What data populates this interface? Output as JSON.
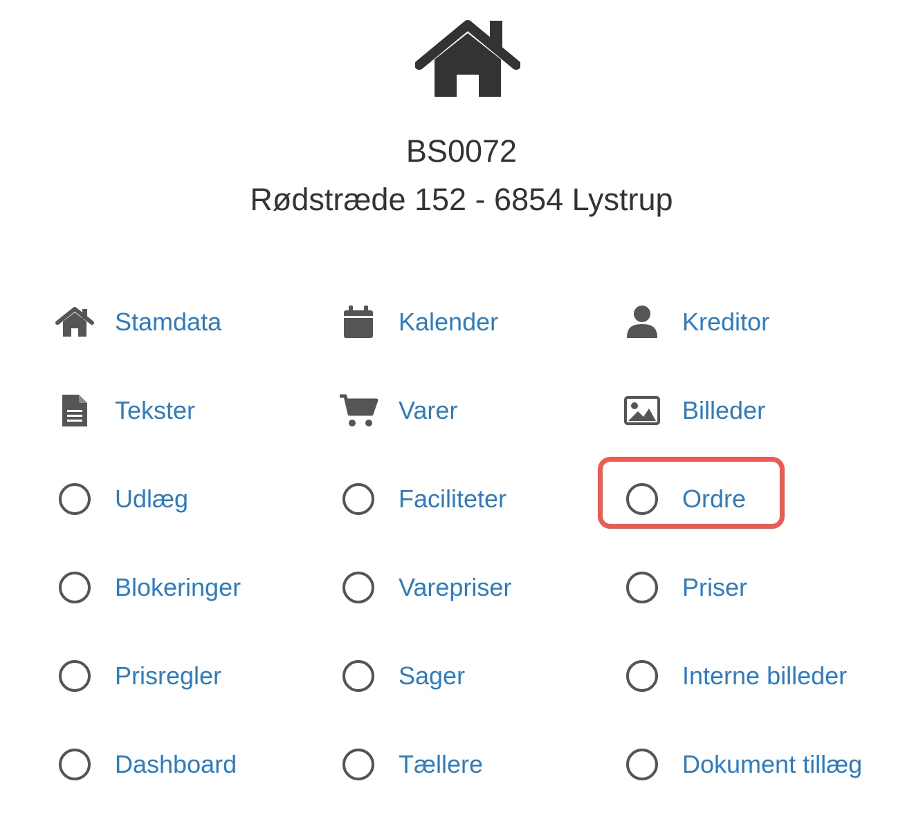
{
  "header": {
    "icon": "house-icon",
    "property_id": "BS0072",
    "address": "Rødstræde 152 - 6854 Lystrup"
  },
  "colors": {
    "link": "#2d7cc1",
    "icon": "#555555",
    "text": "#333333",
    "highlight": "#ee5a4f"
  },
  "menu": {
    "items": [
      {
        "label": "Stamdata",
        "icon": "home-icon"
      },
      {
        "label": "Kalender",
        "icon": "calendar-icon"
      },
      {
        "label": "Kreditor",
        "icon": "user-icon"
      },
      {
        "label": "Tekster",
        "icon": "document-icon"
      },
      {
        "label": "Varer",
        "icon": "cart-icon"
      },
      {
        "label": "Billeder",
        "icon": "image-icon"
      },
      {
        "label": "Udlæg",
        "icon": "circle-icon"
      },
      {
        "label": "Faciliteter",
        "icon": "circle-icon"
      },
      {
        "label": "Ordre",
        "icon": "circle-icon"
      },
      {
        "label": "Blokeringer",
        "icon": "circle-icon"
      },
      {
        "label": "Varepriser",
        "icon": "circle-icon"
      },
      {
        "label": "Priser",
        "icon": "circle-icon"
      },
      {
        "label": "Prisregler",
        "icon": "circle-icon"
      },
      {
        "label": "Sager",
        "icon": "circle-icon"
      },
      {
        "label": "Interne billeder",
        "icon": "circle-icon"
      },
      {
        "label": "Dashboard",
        "icon": "circle-icon"
      },
      {
        "label": "Tællere",
        "icon": "circle-icon"
      },
      {
        "label": "Dokument tillæg",
        "icon": "circle-icon"
      }
    ]
  }
}
